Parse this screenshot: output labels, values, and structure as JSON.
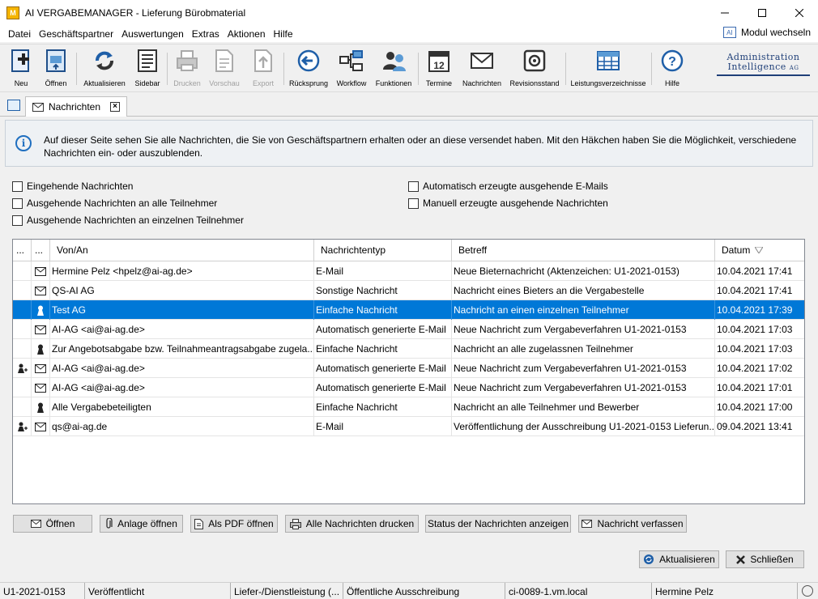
{
  "window": {
    "title": "AI VERGABEMANAGER - Lieferung Bürobmaterial"
  },
  "menu": [
    "Datei",
    "Geschäftspartner",
    "Auswertungen",
    "Extras",
    "Aktionen",
    "Hilfe"
  ],
  "modul_label": "Modul wechseln",
  "toolbar": [
    {
      "label": "Neu",
      "icon": "new-icon"
    },
    {
      "label": "Öffnen",
      "icon": "open-icon"
    },
    {
      "label": "Aktualisieren",
      "icon": "refresh-icon"
    },
    {
      "label": "Sidebar",
      "icon": "sidebar-icon"
    },
    {
      "label": "Drucken",
      "icon": "print-icon",
      "disabled": true
    },
    {
      "label": "Vorschau",
      "icon": "preview-icon",
      "disabled": true
    },
    {
      "label": "Export",
      "icon": "export-icon",
      "disabled": true
    },
    {
      "label": "Rücksprung",
      "icon": "back-icon"
    },
    {
      "label": "Workflow",
      "icon": "workflow-icon"
    },
    {
      "label": "Funktionen",
      "icon": "functions-icon"
    },
    {
      "label": "Termine",
      "icon": "calendar-icon"
    },
    {
      "label": "Nachrichten",
      "icon": "mail-icon"
    },
    {
      "label": "Revisionsstand",
      "icon": "safe-icon"
    },
    {
      "label": "Leistungsverzeichnisse",
      "icon": "table-icon"
    },
    {
      "label": "Hilfe",
      "icon": "help-icon"
    }
  ],
  "logo": {
    "line1": "Administration",
    "line2": "Intelligence",
    "suffix": "AG"
  },
  "tab": {
    "label": "Nachrichten"
  },
  "info_text": "Auf dieser Seite sehen Sie alle Nachrichten, die Sie von Geschäftspartnern erhalten oder an diese versendet haben. Mit den Häkchen haben Sie die Möglichkeit, verschiedene Nachrichten ein- oder auszublenden.",
  "filters": [
    "Eingehende Nachrichten",
    "Ausgehende Nachrichten an alle Teilnehmer",
    "Ausgehende Nachrichten an einzelnen Teilnehmer",
    "Automatisch erzeugte ausgehende E-Mails",
    "Manuell erzeugte ausgehende Nachrichten"
  ],
  "table": {
    "headers": [
      "...",
      "...",
      "Von/An",
      "Nachrichtentyp",
      "Betreff",
      "Datum"
    ],
    "rows": [
      {
        "c1": "",
        "c2": "mail",
        "from": "Hermine Pelz <hpelz@ai-ag.de>",
        "type": "E-Mail",
        "subject": "Neue Bieternachricht (Aktenzeichen: U1-2021-0153)",
        "date": "10.04.2021 17:41"
      },
      {
        "c1": "",
        "c2": "mail",
        "from": "QS-AI AG",
        "type": "Sonstige Nachricht",
        "subject": "Nachricht eines Bieters an die Vergabestelle",
        "date": "10.04.2021 17:41"
      },
      {
        "c1": "",
        "c2": "person",
        "from": "Test AG",
        "type": "Einfache Nachricht",
        "subject": "Nachricht an einen einzelnen Teilnehmer",
        "date": "10.04.2021 17:39",
        "selected": true
      },
      {
        "c1": "",
        "c2": "mail",
        "from": "AI-AG <ai@ai-ag.de>",
        "type": "Automatisch generierte E-Mail",
        "subject": "Neue Nachricht zum Vergabeverfahren U1-2021-0153",
        "date": "10.04.2021 17:03"
      },
      {
        "c1": "",
        "c2": "person",
        "from": "Zur Angebotsabgabe bzw. Teilnahmeantragsabgabe zugela...",
        "type": "Einfache Nachricht",
        "subject": "Nachricht an alle zugelassnen Teilnehmer",
        "date": "10.04.2021 17:03"
      },
      {
        "c1": "attach",
        "c2": "mail",
        "from": "AI-AG <ai@ai-ag.de>",
        "type": "Automatisch generierte E-Mail",
        "subject": "Neue Nachricht zum Vergabeverfahren U1-2021-0153",
        "date": "10.04.2021 17:02"
      },
      {
        "c1": "",
        "c2": "mail",
        "from": "AI-AG <ai@ai-ag.de>",
        "type": "Automatisch generierte E-Mail",
        "subject": "Neue Nachricht zum Vergabeverfahren U1-2021-0153",
        "date": "10.04.2021 17:01"
      },
      {
        "c1": "",
        "c2": "person",
        "from": "Alle Vergabebeteiligten",
        "type": "Einfache Nachricht",
        "subject": "Nachricht an alle Teilnehmer und Bewerber",
        "date": "10.04.2021 17:00"
      },
      {
        "c1": "attach",
        "c2": "mail",
        "from": "qs@ai-ag.de",
        "type": "E-Mail",
        "subject": "Veröffentlichung der Ausschreibung U1-2021-0153 Lieferun...",
        "date": "09.04.2021 13:41"
      }
    ]
  },
  "buttons": [
    "Öffnen",
    "Anlage öffnen",
    "Als PDF öffnen",
    "Alle Nachrichten drucken",
    "Status der Nachrichten anzeigen",
    "Nachricht verfassen"
  ],
  "bottom_buttons": [
    "Aktualisieren",
    "Schließen"
  ],
  "status": [
    "U1-2021-0153",
    "Veröffentlicht",
    "Liefer-/Dienstleistung (...",
    "Öffentliche Ausschreibung",
    "ci-0089-1.vm.local",
    "Hermine Pelz"
  ],
  "colors": {
    "selection": "#0078d7",
    "accent": "#1f6fc0"
  }
}
